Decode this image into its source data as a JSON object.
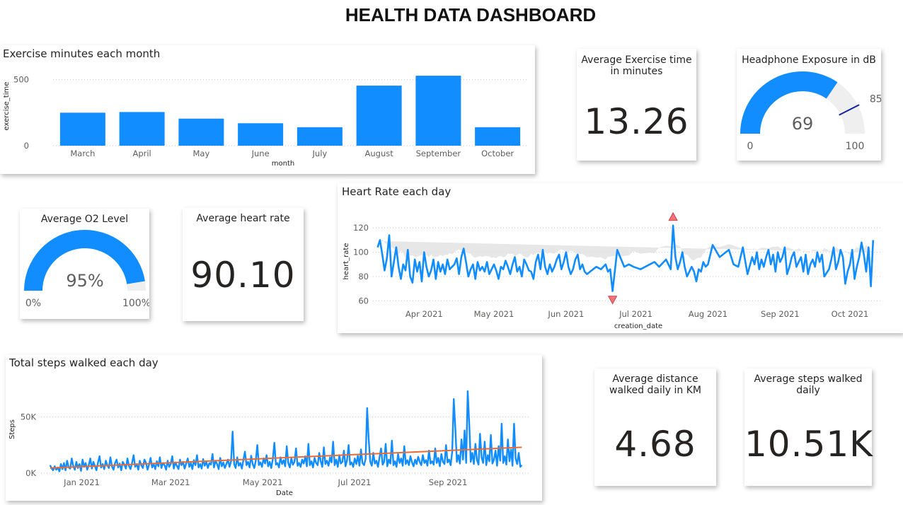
{
  "page": {
    "title": "HEALTH DATA DASHBOARD"
  },
  "colors": {
    "accent": "#118DFF",
    "trend": "#E66C37",
    "band": "#E1E1E1",
    "gauge_bg": "#EFEFEF",
    "target": "#12239E",
    "marker": "#F4727A"
  },
  "exercise_chart": {
    "title": "Exercise minutes each month",
    "chart_data": {
      "type": "bar",
      "title": "Exercise minutes each month",
      "xlabel": "month",
      "ylabel": "exercise_time",
      "categories": [
        "March",
        "April",
        "May",
        "June",
        "July",
        "August",
        "September",
        "October"
      ],
      "values": [
        250,
        255,
        205,
        170,
        140,
        455,
        530,
        140
      ],
      "ylim": [
        0,
        600
      ],
      "yticks": [
        0,
        500
      ],
      "ytick_labels": [
        "0",
        "500"
      ],
      "grid": true
    }
  },
  "kpi_exercise": {
    "label": "Average Exercise time in minutes",
    "value": "13.26"
  },
  "headphone_gauge": {
    "label": "Headphone Exposure in dB",
    "value": 69,
    "value_label": "69",
    "min": 0,
    "min_label": "0",
    "max": 100,
    "max_label": "100",
    "target": 85,
    "target_label": "85"
  },
  "o2_gauge": {
    "label": "Average O2 Level",
    "value": 95,
    "value_label": "95%",
    "min": 0,
    "min_label": "0%",
    "max": 100,
    "max_label": "100%"
  },
  "kpi_heart": {
    "label": "Average heart rate",
    "value": "90.10"
  },
  "heart_chart": {
    "title": "Heart Rate each day",
    "chart_data": {
      "type": "line",
      "title": "Heart Rate each day",
      "xlabel": "creation_date",
      "ylabel": "heart_rate",
      "ylim": [
        55,
        130
      ],
      "yticks": [
        60,
        80,
        100,
        120
      ],
      "ytick_labels": [
        "60",
        "80",
        "100",
        "120"
      ],
      "xlim": [
        "2021-03-10",
        "2021-10-15"
      ],
      "xticks": [
        "2021-04-01",
        "2021-05-01",
        "2021-06-01",
        "2021-07-01",
        "2021-08-01",
        "2021-09-01",
        "2021-10-01"
      ],
      "xtick_labels": [
        "Apr 2021",
        "May 2021",
        "Jun 2021",
        "Jul 2021",
        "Aug 2021",
        "Sep 2021",
        "Oct 2021"
      ],
      "series": [
        {
          "x": [
            "2021-03-12",
            "2021-03-13",
            "2021-03-14",
            "2021-03-15",
            "2021-03-16",
            "2021-03-17",
            "2021-03-18",
            "2021-03-19",
            "2021-03-20",
            "2021-03-21",
            "2021-03-22",
            "2021-03-23",
            "2021-03-24",
            "2021-03-25",
            "2021-03-26",
            "2021-03-27",
            "2021-03-28",
            "2021-03-29",
            "2021-03-30",
            "2021-03-31",
            "2021-04-01",
            "2021-04-02",
            "2021-04-03",
            "2021-04-04",
            "2021-04-05",
            "2021-04-06",
            "2021-04-07",
            "2021-04-08",
            "2021-04-09",
            "2021-04-10",
            "2021-04-11",
            "2021-04-12",
            "2021-04-13",
            "2021-04-14",
            "2021-04-15",
            "2021-04-16",
            "2021-04-17",
            "2021-04-18",
            "2021-04-19",
            "2021-04-20",
            "2021-04-21",
            "2021-04-22",
            "2021-04-23",
            "2021-04-24",
            "2021-04-25",
            "2021-04-26",
            "2021-04-27",
            "2021-04-28",
            "2021-04-29",
            "2021-04-30",
            "2021-05-01",
            "2021-05-02",
            "2021-05-03",
            "2021-05-04",
            "2021-05-05",
            "2021-05-06",
            "2021-05-07",
            "2021-05-08",
            "2021-05-09",
            "2021-05-10",
            "2021-05-11",
            "2021-05-12",
            "2021-05-13",
            "2021-05-14",
            "2021-05-15",
            "2021-05-16",
            "2021-05-17",
            "2021-05-18",
            "2021-05-19",
            "2021-05-20",
            "2021-05-21",
            "2021-05-22",
            "2021-05-23",
            "2021-05-24",
            "2021-05-25",
            "2021-05-26",
            "2021-05-27",
            "2021-05-28",
            "2021-05-29",
            "2021-05-30",
            "2021-05-31",
            "2021-06-01",
            "2021-06-02",
            "2021-06-03",
            "2021-06-04",
            "2021-06-05",
            "2021-06-06",
            "2021-06-07",
            "2021-06-08",
            "2021-06-09",
            "2021-06-10",
            "2021-06-12",
            "2021-06-14",
            "2021-06-16",
            "2021-06-18",
            "2021-06-19",
            "2021-06-20",
            "2021-06-21",
            "2021-06-23",
            "2021-06-26",
            "2021-06-28",
            "2021-06-30",
            "2021-07-03",
            "2021-07-07",
            "2021-07-09",
            "2021-07-11",
            "2021-07-14",
            "2021-07-16",
            "2021-07-17",
            "2021-07-18",
            "2021-07-19",
            "2021-07-20",
            "2021-07-21",
            "2021-07-22",
            "2021-07-23",
            "2021-07-24",
            "2021-07-25",
            "2021-07-26",
            "2021-07-27",
            "2021-07-28",
            "2021-07-29",
            "2021-07-30",
            "2021-07-31",
            "2021-08-01",
            "2021-08-03",
            "2021-08-06",
            "2021-08-10",
            "2021-08-12",
            "2021-08-14",
            "2021-08-16",
            "2021-08-18",
            "2021-08-20",
            "2021-08-21",
            "2021-08-22",
            "2021-08-23",
            "2021-08-24",
            "2021-08-25",
            "2021-08-26",
            "2021-08-27",
            "2021-08-28",
            "2021-08-29",
            "2021-08-30",
            "2021-08-31",
            "2021-09-01",
            "2021-09-02",
            "2021-09-03",
            "2021-09-04",
            "2021-09-05",
            "2021-09-06",
            "2021-09-07",
            "2021-09-08",
            "2021-09-09",
            "2021-09-10",
            "2021-09-11",
            "2021-09-12",
            "2021-09-13",
            "2021-09-14",
            "2021-09-15",
            "2021-09-16",
            "2021-09-17",
            "2021-09-18",
            "2021-09-19",
            "2021-09-20",
            "2021-09-22",
            "2021-09-23",
            "2021-09-24",
            "2021-09-25",
            "2021-09-26",
            "2021-09-27",
            "2021-09-28",
            "2021-09-29",
            "2021-09-30",
            "2021-10-01",
            "2021-10-02",
            "2021-10-03",
            "2021-10-04",
            "2021-10-05",
            "2021-10-06",
            "2021-10-07",
            "2021-10-08",
            "2021-10-09",
            "2021-10-10",
            "2021-10-11"
          ],
          "values": [
            104,
            110,
            98,
            85,
            95,
            114,
            80,
            92,
            104,
            88,
            78,
            90,
            85,
            102,
            80,
            75,
            94,
            84,
            92,
            76,
            100,
            88,
            80,
            85,
            94,
            78,
            92,
            84,
            90,
            82,
            94,
            86,
            88,
            90,
            95,
            82,
            96,
            103,
            92,
            80,
            86,
            90,
            78,
            92,
            85,
            88,
            84,
            92,
            82,
            86,
            90,
            85,
            78,
            88,
            86,
            93,
            88,
            82,
            90,
            96,
            84,
            88,
            80,
            94,
            90,
            85,
            84,
            78,
            92,
            98,
            86,
            102,
            88,
            82,
            90,
            84,
            88,
            94,
            98,
            86,
            92,
            100,
            88,
            82,
            86,
            94,
            98,
            86,
            90,
            84,
            82,
            85,
            88,
            86,
            90,
            84,
            86,
            68,
            102,
            88,
            90,
            88,
            86,
            90,
            92,
            88,
            94,
            86,
            122,
            96,
            86,
            92,
            100,
            88,
            80,
            84,
            88,
            84,
            76,
            86,
            84,
            92,
            88,
            90,
            106,
            96,
            102,
            90,
            88,
            104,
            82,
            96,
            90,
            100,
            86,
            94,
            88,
            96,
            102,
            90,
            98,
            84,
            100,
            92,
            96,
            104,
            82,
            88,
            96,
            100,
            88,
            92,
            96,
            84,
            98,
            82,
            90,
            94,
            88,
            100,
            92,
            98,
            80,
            86,
            94,
            104,
            86,
            92,
            102,
            96,
            74,
            84,
            90,
            102,
            78,
            88,
            96,
            108,
            98,
            84,
            104,
            72,
            110,
            80,
            88
          ],
          "max_label": "max",
          "min_label": "min"
        }
      ]
    }
  },
  "steps_chart": {
    "title": "Total steps walked each day",
    "chart_data": {
      "type": "line",
      "title": "Total steps walked each day",
      "xlabel": "Date",
      "ylabel": "Steps",
      "ylim": [
        -2000,
        80000
      ],
      "yticks": [
        0,
        50000
      ],
      "ytick_labels": [
        "0K",
        "50K"
      ],
      "xlim": [
        "2020-12-05",
        "2021-10-25"
      ],
      "xticks": [
        "2021-01-01",
        "2021-03-01",
        "2021-05-01",
        "2021-07-01",
        "2021-09-01"
      ],
      "xtick_labels": [
        "Jan 2021",
        "Mar 2021",
        "May 2021",
        "Jul 2021",
        "Sep 2021"
      ],
      "series": [
        {
          "name": "Steps",
          "start": "2020-12-11",
          "end": "2021-10-20",
          "values": [
            7000,
            4000,
            2500,
            6000,
            3000,
            5000,
            1500,
            8000,
            3500,
            9000,
            2500,
            11000,
            5000,
            4000,
            13000,
            6000,
            3000,
            10000,
            4500,
            8000,
            2000,
            12000,
            5500,
            9000,
            3000,
            7000,
            13000,
            4000,
            10000,
            6000,
            2500,
            9500,
            15000,
            5000,
            8000,
            3500,
            11000,
            7000,
            4500,
            14000,
            6000,
            3000,
            9000,
            12000,
            5000,
            8500,
            2500,
            10000,
            7500,
            4000,
            13000,
            6500,
            3500,
            9000,
            16000,
            5500,
            8000,
            3000,
            11000,
            7000,
            4500,
            12000,
            9000,
            3000,
            7500,
            13500,
            5000,
            8000,
            3500,
            10500,
            6000,
            14000,
            4500,
            9000,
            7000,
            3000,
            11000,
            5500,
            8000,
            15000,
            4000,
            9500,
            6500,
            3500,
            12000,
            7000,
            10000,
            4000,
            8500,
            13000,
            5500,
            9000,
            3500,
            11500,
            7000,
            16000,
            5000,
            8000,
            4000,
            12500,
            6500,
            10000,
            4500,
            9000,
            7500,
            17000,
            5000,
            11000,
            8000,
            3500,
            13500,
            6000,
            9500,
            4500,
            8000,
            12000,
            5500,
            10500,
            37000,
            8000,
            4500,
            14000,
            6500,
            9000,
            4000,
            12000,
            19000,
            7000,
            10000,
            5000,
            15500,
            8000,
            4500,
            11000,
            25000,
            7000,
            9500,
            5500,
            13000,
            8500,
            16000,
            6000,
            10000,
            4500,
            12500,
            27000,
            7500,
            9000,
            5000,
            14000,
            8000,
            11500,
            6000,
            24000,
            9000,
            5000,
            13000,
            7500,
            10000,
            22000,
            6500,
            9000,
            5500,
            12000,
            8500,
            15000,
            6000,
            26000,
            7000,
            10500,
            5000,
            13500,
            9000,
            7000,
            18000,
            10500,
            5500,
            23000,
            8000,
            11000,
            6500,
            14000,
            9500,
            28000,
            7000,
            12000,
            5500,
            16000,
            8500,
            10000,
            20000,
            6000,
            11500,
            25000,
            7500,
            9500,
            5500,
            13000,
            8000,
            15500,
            6500,
            21000,
            9000,
            7000,
            12500,
            58000,
            30000,
            10000,
            6500,
            18000,
            8500,
            11000,
            5500,
            14000,
            22000,
            7500,
            10000,
            26000,
            6000,
            12000,
            8500,
            29000,
            7000,
            10500,
            5500,
            17000,
            9000,
            13000,
            6500,
            24000,
            8000,
            11500,
            7000,
            15000,
            9500,
            6000,
            12000,
            8000,
            14500,
            10000,
            7000,
            16000,
            9000,
            11500,
            6500,
            20000,
            8500,
            10500,
            7500,
            22000,
            9000,
            13500,
            6000,
            17000,
            10000,
            8000,
            25000,
            9500,
            12000,
            7000,
            19000,
            66000,
            40000,
            10000,
            16000,
            8500,
            30000,
            12000,
            38000,
            9000,
            73000,
            45000,
            10000,
            18000,
            8000,
            26000,
            11500,
            7500,
            35000,
            14000,
            9000,
            28000,
            7000,
            16000,
            10500,
            34000,
            8500,
            12000,
            20000,
            6500,
            24000,
            11000,
            44000,
            9000,
            15000,
            7500,
            30000,
            10500,
            21000,
            6500,
            44000,
            13000,
            8000,
            18000,
            5500,
            7000
          ],
          "trend_start": 4500,
          "trend_end": 23000
        }
      ]
    }
  },
  "kpi_distance": {
    "label": "Average distance walked daily in KM",
    "value": "4.68"
  },
  "kpi_steps": {
    "label": "Average steps walked daily",
    "value": "10.51K"
  }
}
